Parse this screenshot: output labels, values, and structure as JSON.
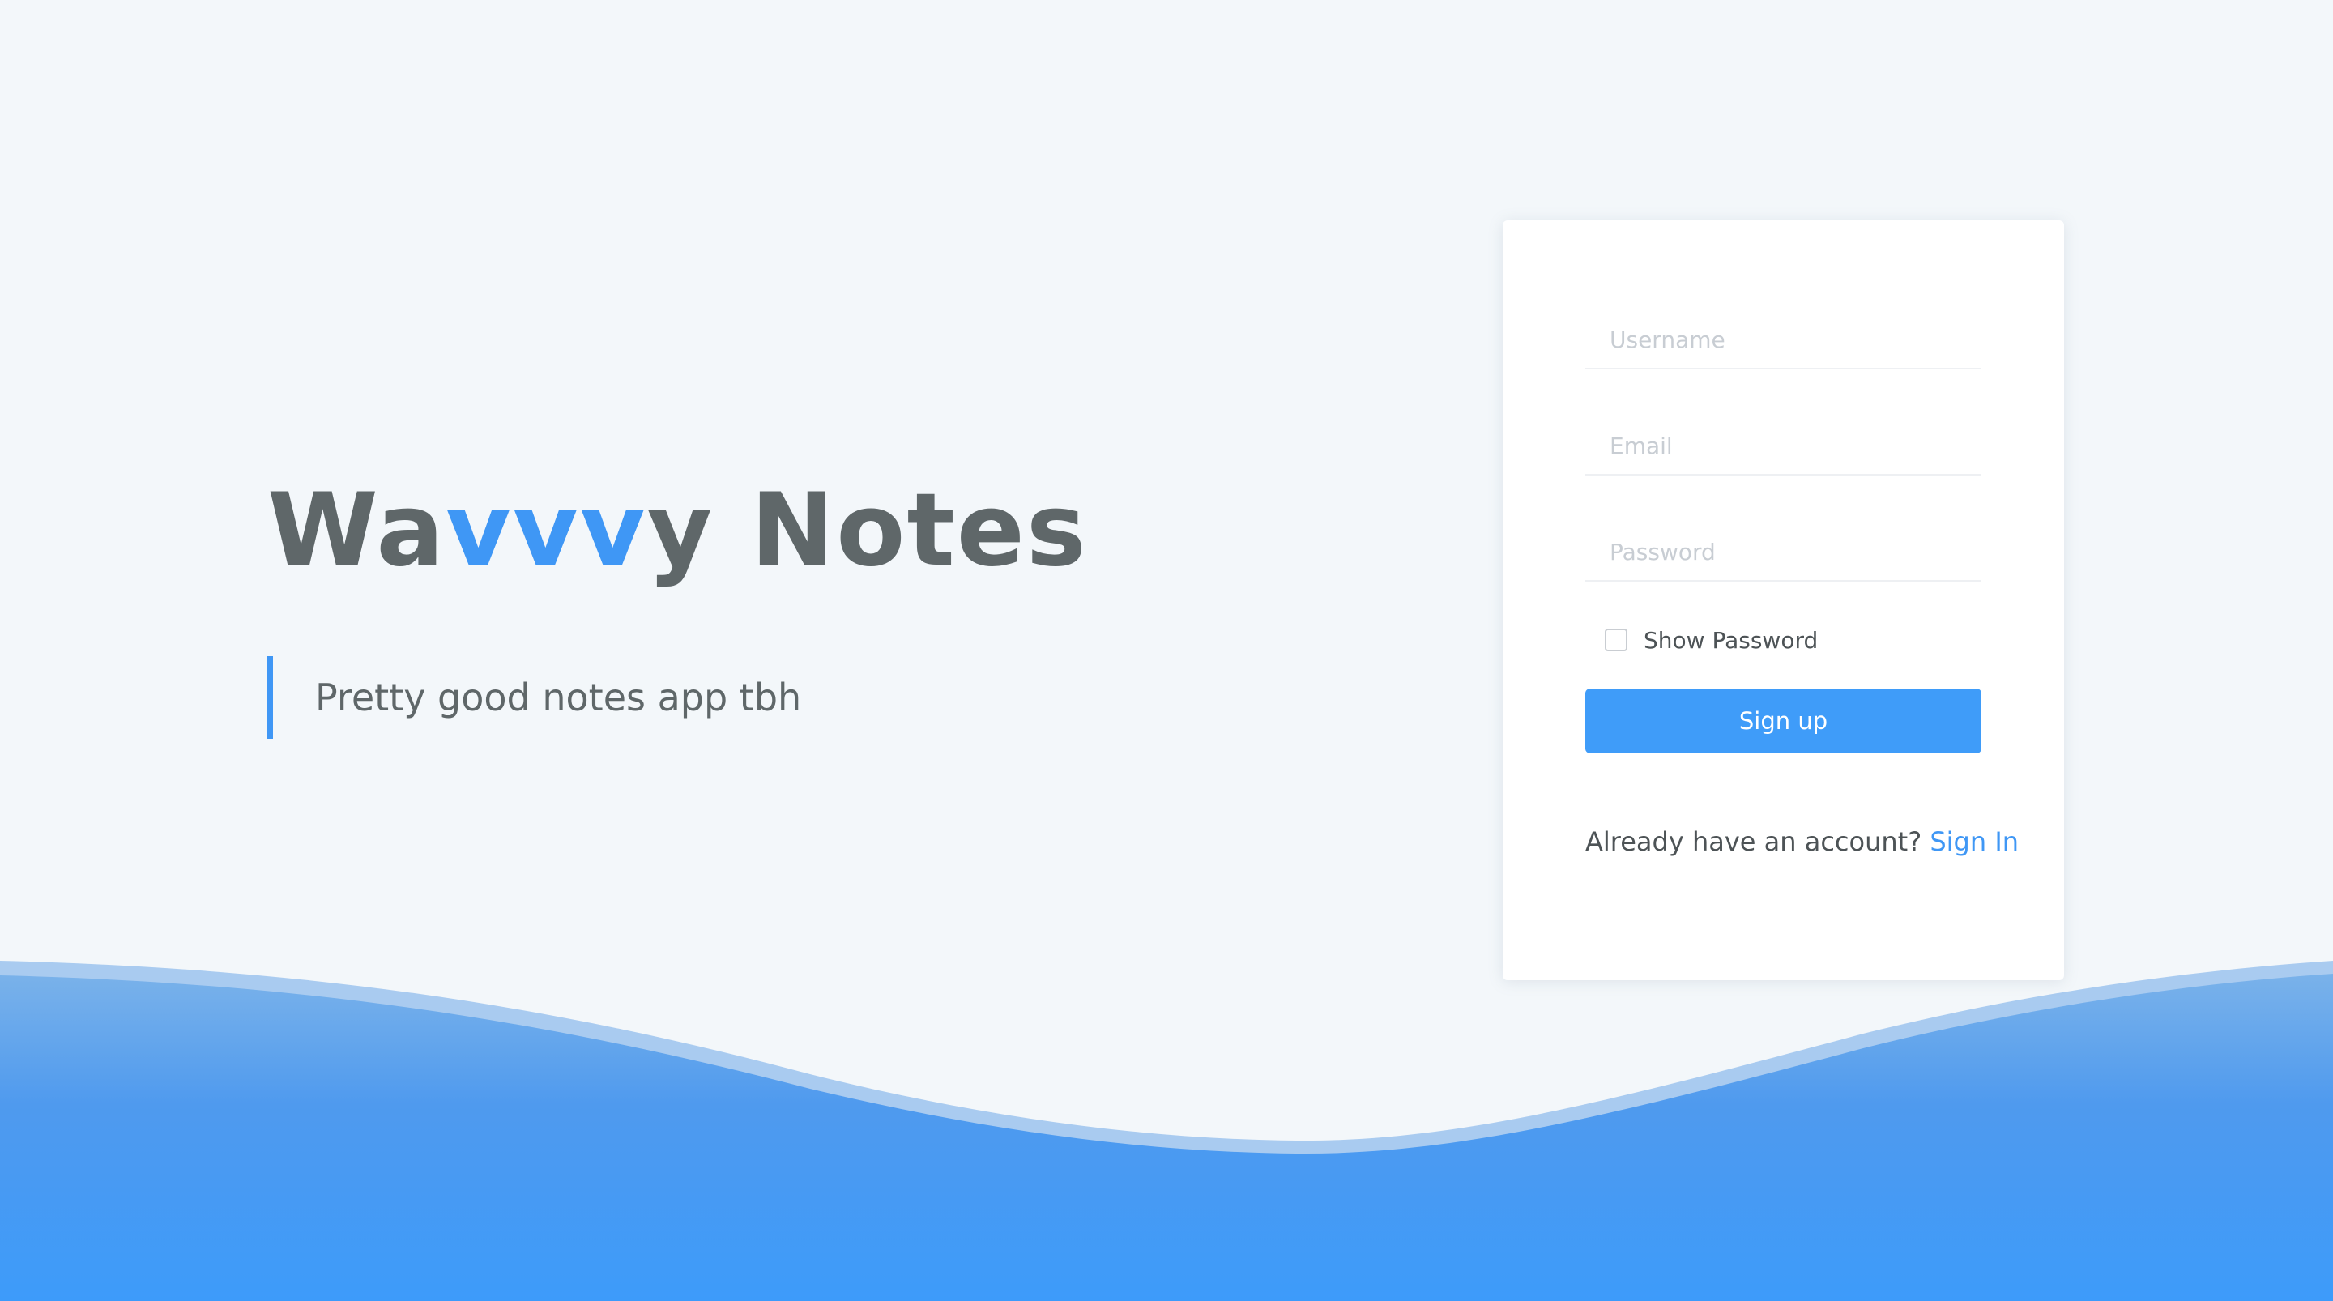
{
  "brand": {
    "title_pre": "Wa",
    "title_accent": "vvv",
    "title_post": "y Notes",
    "tagline": "Pretty good notes app tbh"
  },
  "form": {
    "username_placeholder": "Username",
    "email_placeholder": "Email",
    "password_placeholder": "Password",
    "show_password_label": "Show Password",
    "show_password_checked": false,
    "signup_label": "Sign up",
    "already_text": "Already have an account?",
    "signin_link": "Sign In"
  },
  "colors": {
    "accent": "#3f97f5",
    "button": "#3f9cf9",
    "text": "#5f6769",
    "background": "#f3f7fa"
  }
}
